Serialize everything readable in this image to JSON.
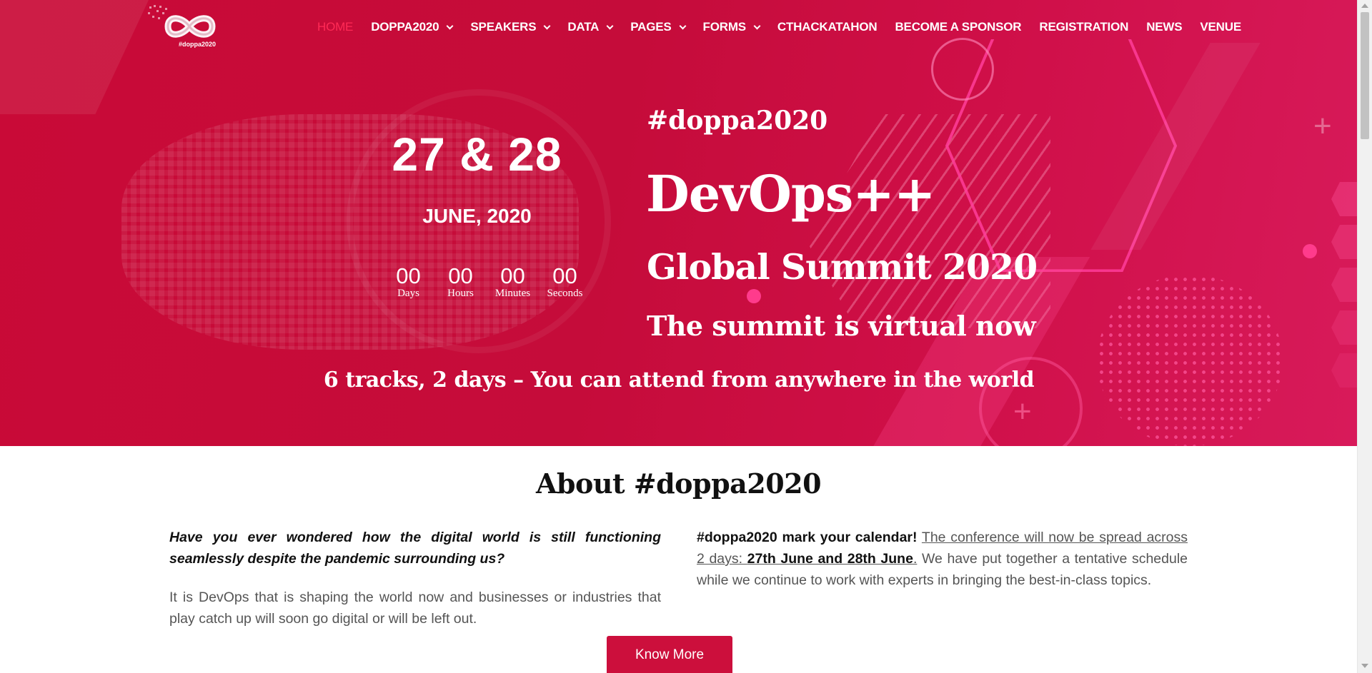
{
  "logo": {
    "caption": "#doppa2020",
    "icon": "infinity-logo-icon"
  },
  "nav": {
    "items": [
      {
        "label": "Home",
        "active": true,
        "dropdown": false
      },
      {
        "label": "doppa2020",
        "active": false,
        "dropdown": true
      },
      {
        "label": "Speakers",
        "active": false,
        "dropdown": true
      },
      {
        "label": "Data",
        "active": false,
        "dropdown": true
      },
      {
        "label": "Pages",
        "active": false,
        "dropdown": true
      },
      {
        "label": "Forms",
        "active": false,
        "dropdown": true
      },
      {
        "label": "CTHackatahon",
        "active": false,
        "dropdown": false
      },
      {
        "label": "Become a Sponsor",
        "active": false,
        "dropdown": false
      },
      {
        "label": "Registration",
        "active": false,
        "dropdown": false
      },
      {
        "label": "News",
        "active": false,
        "dropdown": false
      },
      {
        "label": "Venue",
        "active": false,
        "dropdown": false
      }
    ]
  },
  "hero": {
    "dates": "27 & 28",
    "month": "JUNE, 2020",
    "countdown": [
      {
        "value": "00",
        "label": "Days"
      },
      {
        "value": "00",
        "label": "Hours"
      },
      {
        "value": "00",
        "label": "Minutes"
      },
      {
        "value": "00",
        "label": "Seconds"
      }
    ],
    "hashtag": "#doppa2020",
    "title": "DevOps++",
    "subtitle": "Global Summit 2020",
    "virtual_note": "The summit is virtual now",
    "tracks": "6 tracks, 2 days – You can attend from anywhere in the world"
  },
  "about": {
    "title": "About #doppa2020",
    "left_question": "Have you ever wondered how the digital world is still functioning seamlessly despite the pandemic surrounding us?",
    "left_paragraph": "It is DevOps that is shaping the world now and businesses or industries that play catch up will soon go digital or will be left out.",
    "right_bold": "#doppa2020 mark your calendar!",
    "right_underlined_1": "The conference will now be spread across 2 days: ",
    "right_underlined_bold": "27th June and 28th June",
    "right_underlined_end": ".",
    "right_rest": " We have put together a tentative schedule while we continue to work with experts in bringing the best-in-class topics.",
    "button": "Know More"
  },
  "colors": {
    "hero": "#c90a37",
    "accent": "#ff2a55",
    "button": "#cc0f3c"
  }
}
